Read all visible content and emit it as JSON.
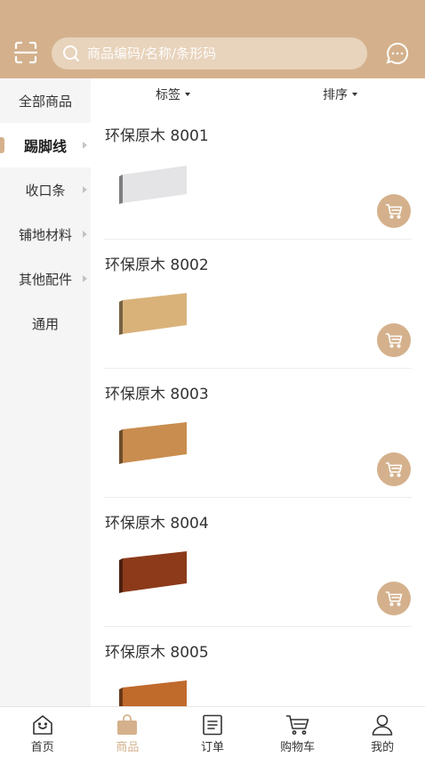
{
  "colors": {
    "accent": "#d4b18c",
    "sidebar_bg": "#f5f5f5"
  },
  "header": {
    "search_placeholder": "商品编码/名称/条形码",
    "scan_icon": "scan-icon",
    "message_icon": "message-icon"
  },
  "sidebar": {
    "items": [
      {
        "label": "全部商品",
        "active": false,
        "arrow": false
      },
      {
        "label": "踢脚线",
        "active": true,
        "arrow": true
      },
      {
        "label": "收口条",
        "active": false,
        "arrow": true
      },
      {
        "label": "铺地材料",
        "active": false,
        "arrow": true
      },
      {
        "label": "其他配件",
        "active": false,
        "arrow": true
      },
      {
        "label": "通用",
        "active": false,
        "arrow": false
      }
    ]
  },
  "filters": {
    "tag_label": "标签",
    "sort_label": "排序"
  },
  "products": [
    {
      "name": "环保原木 8001",
      "color": "#e4e4e6"
    },
    {
      "name": "环保原木 8002",
      "color": "#d9b27a"
    },
    {
      "name": "环保原木 8003",
      "color": "#c98d4f"
    },
    {
      "name": "环保原木 8004",
      "color": "#8c3a1a"
    },
    {
      "name": "环保原木 8005",
      "color": "#c06a2c"
    }
  ],
  "tabbar": {
    "items": [
      {
        "label": "首页",
        "icon": "home-icon",
        "active": false
      },
      {
        "label": "商品",
        "icon": "bag-icon",
        "active": true
      },
      {
        "label": "订单",
        "icon": "order-icon",
        "active": false
      },
      {
        "label": "购物车",
        "icon": "cart-icon",
        "active": false
      },
      {
        "label": "我的",
        "icon": "user-icon",
        "active": false
      }
    ]
  }
}
